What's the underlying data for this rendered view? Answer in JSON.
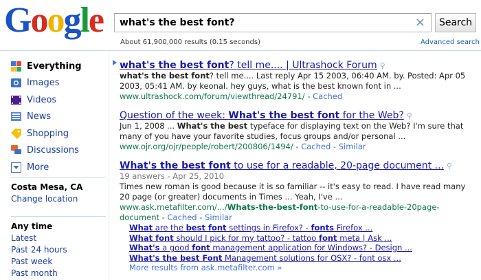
{
  "logo": {
    "letters": [
      "G",
      "o",
      "o",
      "g",
      "l",
      "e"
    ],
    "colors": [
      "#1a53c6",
      "#d62d20",
      "#f0b400",
      "#1a53c6",
      "#189a3a",
      "#d62d20"
    ]
  },
  "search": {
    "query": "what's the best font?",
    "button_label": "Search",
    "clear_symbol": "×"
  },
  "stats": "About 61,900,000 results (0.15 seconds)",
  "advanced_search": "Advanced search",
  "sidebar": {
    "items": [
      {
        "label": "Everything",
        "icon": "everything-icon",
        "selected": true
      },
      {
        "label": "Images",
        "icon": "images-icon"
      },
      {
        "label": "Videos",
        "icon": "videos-icon"
      },
      {
        "label": "News",
        "icon": "news-icon"
      },
      {
        "label": "Shopping",
        "icon": "shopping-icon"
      },
      {
        "label": "Discussions",
        "icon": "discussions-icon"
      },
      {
        "label": "More",
        "icon": "more-icon"
      }
    ],
    "location": {
      "title": "Costa Mesa, CA",
      "change": "Change location"
    },
    "time": {
      "title": "Any time",
      "options": [
        "Latest",
        "Past 24 hours",
        "Past week",
        "Past month"
      ]
    }
  },
  "results": [
    {
      "title_parts": [
        "what's the best font",
        "? tell me.... | Ultrashock Forum"
      ],
      "snippet_parts": [
        "what's the best font",
        "? tell me.... Last reply Apr 15 2003, 06:40 AM. by. Posted: Apr 05 2003, 05:41 AM. by keonal. hey guys, what is the best known font in ..."
      ],
      "url": "www.ultrashock.com/forum/viewthread/24791/",
      "links": [
        "Cached"
      ]
    },
    {
      "title_parts": [
        "Question of the week: ",
        "What's the best font",
        " for the Web?"
      ],
      "snippet_parts": [
        "Jun 1, 2008 ... ",
        "What's the best",
        " typeface for displaying text on the Web? I'm sure that many of you have your favorite studies, focus groups and/or personal ..."
      ],
      "url": "www.ojr.org/ojr/people/robert/200806/1494/",
      "links": [
        "Cached",
        "Similar"
      ]
    },
    {
      "title_parts": [
        "What's the best font",
        " to use for a readable, 20-page document ..."
      ],
      "meta": "19 answers - Apr 25, 2010",
      "snippet": "Times new roman is good because it is so familiar -- it's easy to read. I have read many 20 page (or greater) documents in Times ... Yeah, I've ...",
      "url_parts": [
        "www.ask.metafilter.com/.../",
        "Whats-the-best-font",
        "-to-use-for-a-readable-20page-document"
      ],
      "links": [
        "Cached",
        "Similar"
      ],
      "sublinks": [
        [
          "What",
          " are the ",
          "best font",
          " settings in Firefox? - ",
          "fonts",
          " Firefox ..."
        ],
        [
          "What font",
          " should I pick for my tattoo? - tattoo ",
          "font",
          " meta | Ask ..."
        ],
        [
          "What's",
          " a good ",
          "font",
          " management application for Windows? - Design ..."
        ],
        [
          "What's the best Font",
          " Management solutions for OSX? - font osx ..."
        ]
      ],
      "more": "More results from ask.metafilter.com »"
    }
  ]
}
